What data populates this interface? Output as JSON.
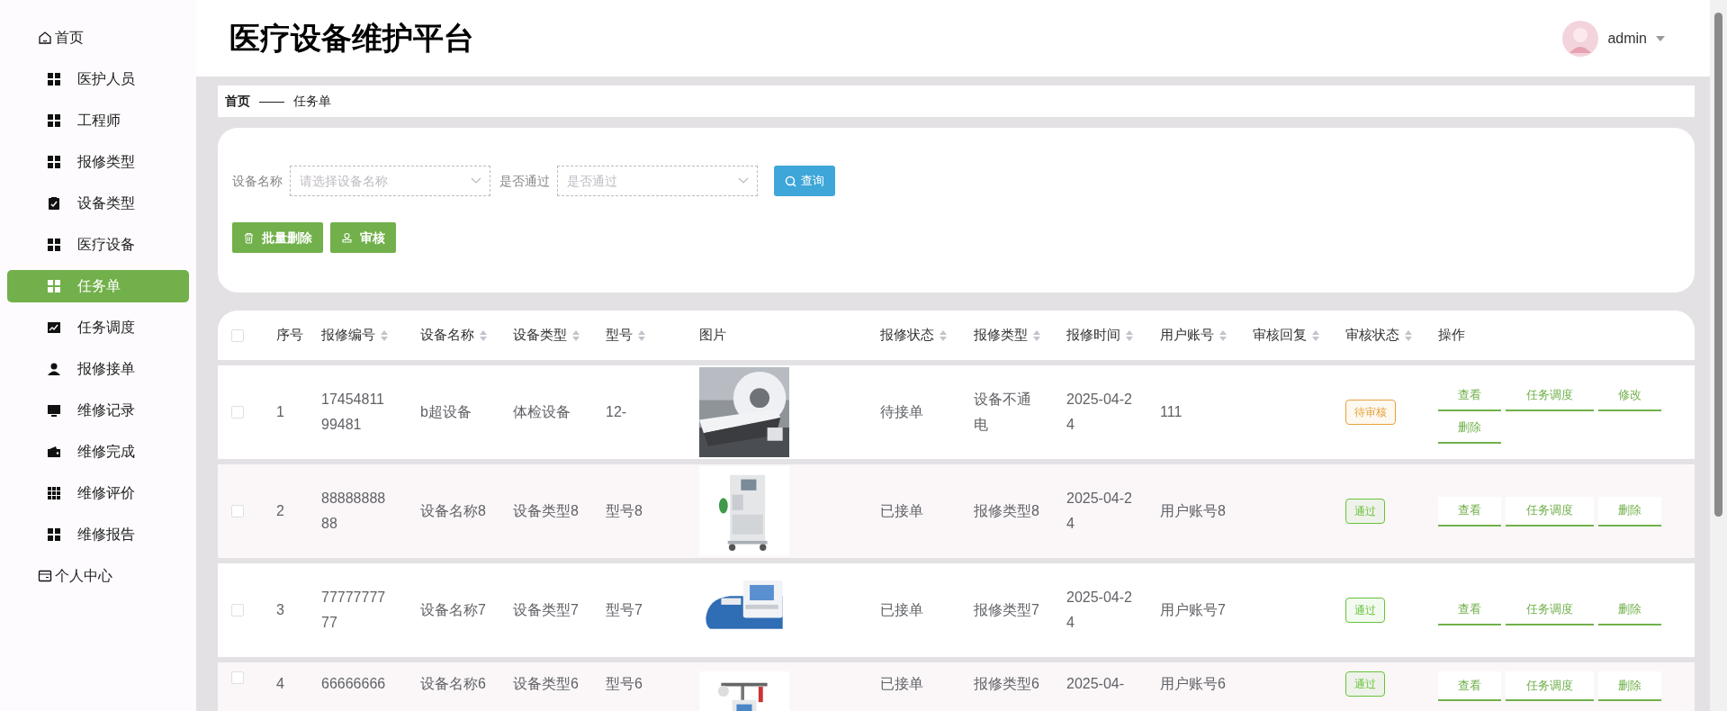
{
  "sidebar": {
    "items": [
      {
        "label": "首页",
        "kind": "link",
        "selected": false
      },
      {
        "label": "医护人员",
        "kind": "menu",
        "selected": false
      },
      {
        "label": "工程师",
        "kind": "menu",
        "selected": false
      },
      {
        "label": "报修类型",
        "kind": "menu",
        "selected": false
      },
      {
        "label": "设备类型",
        "kind": "menu",
        "selected": false
      },
      {
        "label": "医疗设备",
        "kind": "menu",
        "selected": false
      },
      {
        "label": "任务单",
        "kind": "menu",
        "selected": true
      },
      {
        "label": "任务调度",
        "kind": "menu",
        "selected": false
      },
      {
        "label": "报修接单",
        "kind": "menu",
        "selected": false
      },
      {
        "label": "维修记录",
        "kind": "menu",
        "selected": false
      },
      {
        "label": "维修完成",
        "kind": "menu",
        "selected": false
      },
      {
        "label": "维修评价",
        "kind": "menu",
        "selected": false
      },
      {
        "label": "维修报告",
        "kind": "menu",
        "selected": false
      },
      {
        "label": "个人中心",
        "kind": "link",
        "selected": false
      }
    ]
  },
  "header": {
    "title": "医疗设备维护平台",
    "user": "admin"
  },
  "breadcrumb": [
    "首页",
    "——",
    "任务单"
  ],
  "filters": [
    {
      "label": "设备名称",
      "placeholder": "请选择设备名称"
    },
    {
      "label": "是否通过",
      "placeholder": "是否通过"
    }
  ],
  "search_button": "查询",
  "action_buttons": [
    {
      "label": "批量删除",
      "kind": "delete"
    },
    {
      "label": "审核",
      "kind": "audit"
    }
  ],
  "table": {
    "select_all": {
      "checked": false
    },
    "columns": [
      {
        "label": "序号",
        "sortable": false
      },
      {
        "label": "报修编号",
        "sortable": true
      },
      {
        "label": "设备名称",
        "sortable": true
      },
      {
        "label": "设备类型",
        "sortable": true
      },
      {
        "label": "型号",
        "sortable": true
      },
      {
        "label": "图片",
        "sortable": false
      },
      {
        "label": "报修状态",
        "sortable": true
      },
      {
        "label": "报修类型",
        "sortable": true
      },
      {
        "label": "报修时间",
        "sortable": true
      },
      {
        "label": "用户账号",
        "sortable": true
      },
      {
        "label": "审核回复",
        "sortable": true
      },
      {
        "label": "审核状态",
        "sortable": true
      },
      {
        "label": "操作",
        "sortable": false
      }
    ],
    "rows": [
      {
        "checked": false,
        "index": "1",
        "code": "1745481199481",
        "device_name": "b超设备",
        "device_type": "体检设备",
        "model": "12-",
        "repair_status": "待接单",
        "repair_type": "设备不通电",
        "time": "2025-04-24",
        "account": "111",
        "audit_status": {
          "text": "待审核",
          "color": "#e6a23c"
        },
        "actions": [
          "查看",
          "任务调度",
          "修改",
          "删除"
        ]
      },
      {
        "checked": false,
        "index": "2",
        "code": "8888888888",
        "device_name": "设备名称8",
        "device_type": "设备类型8",
        "model": "型号8",
        "repair_status": "已接单",
        "repair_type": "报修类型8",
        "time": "2025-04-24",
        "account": "用户账号8",
        "audit_status": {
          "text": "通过",
          "color": "#67c23a"
        },
        "actions": [
          "查看",
          "任务调度",
          "删除"
        ]
      },
      {
        "checked": false,
        "index": "3",
        "code": "7777777777",
        "device_name": "设备名称7",
        "device_type": "设备类型7",
        "model": "型号7",
        "repair_status": "已接单",
        "repair_type": "报修类型7",
        "time": "2025-04-24",
        "account": "用户账号7",
        "audit_status": {
          "text": "通过",
          "color": "#67c23a"
        },
        "actions": [
          "查看",
          "任务调度",
          "删除"
        ]
      },
      {
        "checked": false,
        "index": "4",
        "code": "66666666",
        "device_name": "设备名称6",
        "device_type": "设备类型6",
        "model": "型号6",
        "repair_status": "已接单",
        "repair_type": "报修类型6",
        "time": "2025-04-",
        "account": "用户账号6",
        "audit_status": {
          "text": "通过",
          "color": "#67c23a"
        },
        "actions": [
          "查看",
          "任务调度",
          "删除"
        ]
      }
    ]
  }
}
